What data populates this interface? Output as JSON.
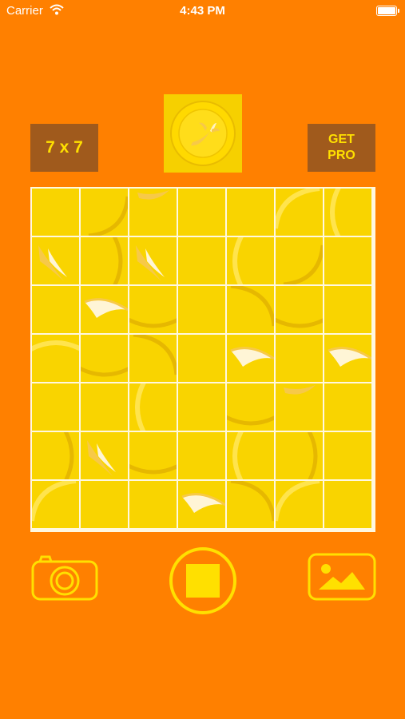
{
  "status_bar": {
    "carrier": "Carrier",
    "time": "4:43 PM"
  },
  "toolbar": {
    "size_label": "7 x 7",
    "pro_label": "GET\nPRO"
  },
  "board": {
    "rows": 7,
    "cols": 7,
    "colors": {
      "tile_base": "#F9D400",
      "tile_light": "#FFE44D",
      "tile_shadow": "#E6B800",
      "banana_peel": "#F7C948",
      "banana_flesh": "#FFF5D6",
      "grid_line": "#FFF8E0"
    },
    "tiles": [
      [
        "plain",
        "ring-br",
        "banana-tip",
        "plain",
        "plain",
        "ring-tl",
        "ring-l"
      ],
      [
        "banana-peel",
        "ring-r",
        "banana-peel",
        "plain",
        "ring-l",
        "ring-br",
        "plain"
      ],
      [
        "plain",
        "banana-flesh",
        "ring-b",
        "plain",
        "ring-tr",
        "ring-b",
        "plain"
      ],
      [
        "ring-t",
        "ring-b",
        "ring-tr",
        "plain",
        "banana-flesh",
        "plain",
        "banana-flesh"
      ],
      [
        "plain",
        "plain",
        "ring-l",
        "plain",
        "ring-b",
        "banana-tip",
        "plain"
      ],
      [
        "ring-r",
        "banana-peel",
        "ring-b",
        "plain",
        "ring-l",
        "ring-r",
        "plain"
      ],
      [
        "ring-tl",
        "plain",
        "plain",
        "banana-flesh",
        "ring-tr",
        "ring-tl",
        "plain"
      ]
    ]
  },
  "controls": {
    "camera_icon": "camera-icon",
    "stop_icon": "stop-icon",
    "gallery_icon": "image-icon",
    "icon_color": "#FFE000"
  },
  "colors": {
    "background": "#FF8000",
    "button_bg": "#A05A1C",
    "button_text": "#FFE000"
  }
}
